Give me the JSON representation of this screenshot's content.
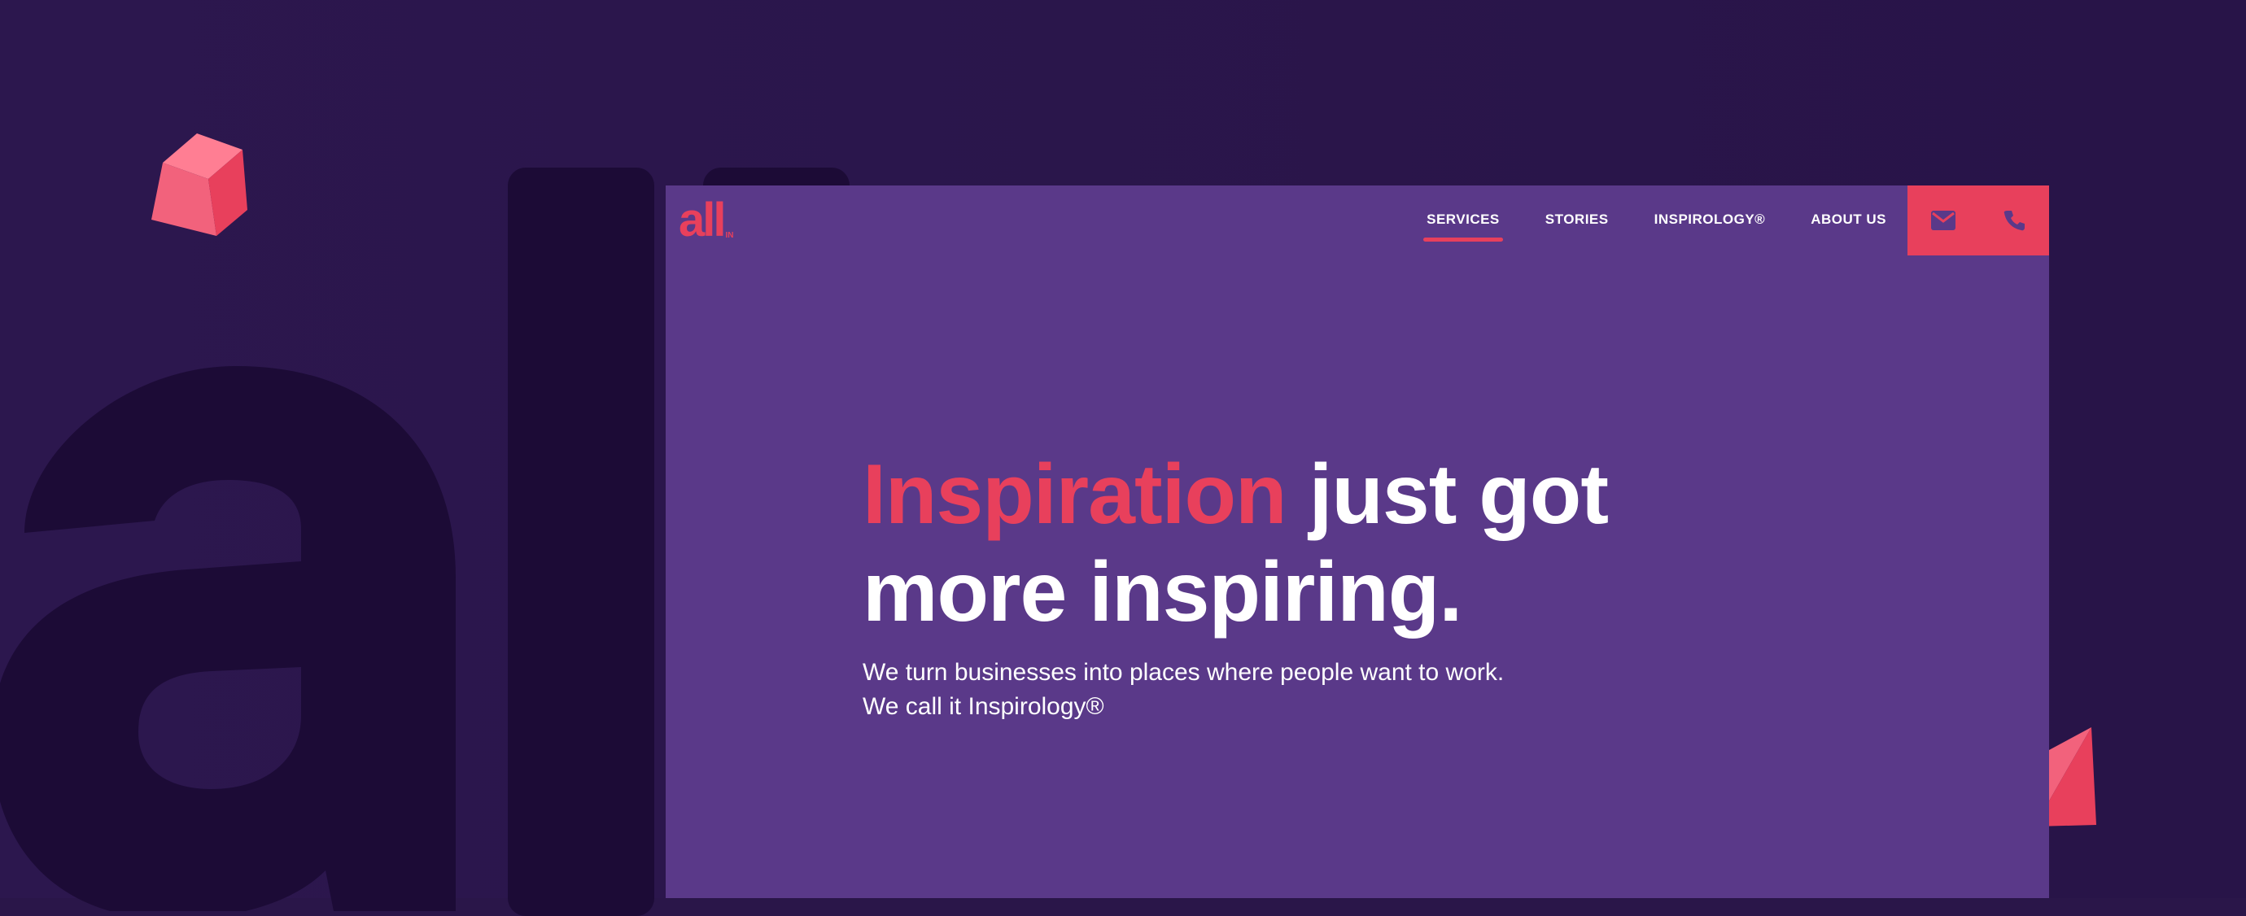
{
  "logo": {
    "main": "all",
    "sub": "IN"
  },
  "nav": {
    "items": [
      {
        "label": "SERVICES"
      },
      {
        "label": "STORIES"
      },
      {
        "label": "INSPIROLOGY®"
      },
      {
        "label": "ABOUT US"
      }
    ],
    "active_index": 0
  },
  "contact": {
    "email_icon": "envelope-icon",
    "phone_icon": "phone-icon"
  },
  "hero": {
    "headline_accent": "Inspiration",
    "headline_rest": " just got",
    "headline_line2": "more inspiring.",
    "subline_1": "We turn businesses into places where people want to work.",
    "subline_2": "We call it Inspirology®"
  },
  "colors": {
    "background": "#2a1649",
    "panel": "#5a3989",
    "accent": "#e8405c",
    "text": "#ffffff",
    "dark_letter": "#1c0b36"
  }
}
